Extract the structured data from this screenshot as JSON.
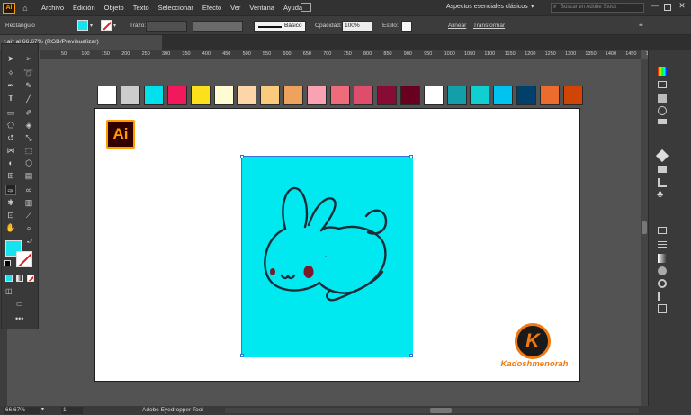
{
  "app": {
    "logo": "Ai",
    "accent": "#FF9A00",
    "logo_bg": "#330000"
  },
  "menu": [
    "Archivo",
    "Edición",
    "Objeto",
    "Texto",
    "Seleccionar",
    "Efecto",
    "Ver",
    "Ventana",
    "Ayuda"
  ],
  "workspace": {
    "label": "Aspectos esenciales clásicos",
    "search_placeholder": "Buscar en Adobe Stock"
  },
  "control": {
    "object_type": "Rectángulo",
    "stroke_label": "Trazo:",
    "stroke_style": "Básico",
    "opacity_label": "Opacidad:",
    "opacity_value": "100%",
    "style_label": "Estilo:",
    "align_label": "Alinear",
    "transform_label": "Transformar",
    "fill_color": "#17E3F0"
  },
  "document": {
    "tab_title": "r.ai* al 66,67% (RGB/Previsualizar)"
  },
  "ruler": {
    "ticks": [
      "50",
      "100",
      "150",
      "200",
      "250",
      "300",
      "350",
      "400",
      "450",
      "500",
      "550",
      "600",
      "650",
      "700",
      "750",
      "800",
      "850",
      "900",
      "950",
      "1000",
      "1050",
      "1100",
      "1150",
      "1200",
      "1250",
      "1300",
      "1350",
      "1400",
      "1450",
      "150"
    ]
  },
  "swatches": [
    "#FFFFFF",
    "#CCCCCC",
    "#00E1EC",
    "#F2185C",
    "#FCE01B",
    "#FFFCD3",
    "#FCD6A8",
    "#FBCB7D",
    "#EEA25E",
    "#F8A2B4",
    "#EE6B7B",
    "#DE4E6C",
    "#870C33",
    "#69001F",
    "#FFFFFF",
    "#139FA9",
    "#10CFD0",
    "#00C3F1",
    "#00406B",
    "#EC6C30",
    "#D04506"
  ],
  "artwork": {
    "bg": "#00E8F0",
    "line": "#1a2e3a",
    "cheek": "#7a1a2a"
  },
  "watermark": {
    "letter": "K",
    "name": "Kadoshmenorah"
  },
  "status": {
    "zoom": "66,67%",
    "page": "1",
    "tool": "Adobe Eyedropper Tool"
  }
}
